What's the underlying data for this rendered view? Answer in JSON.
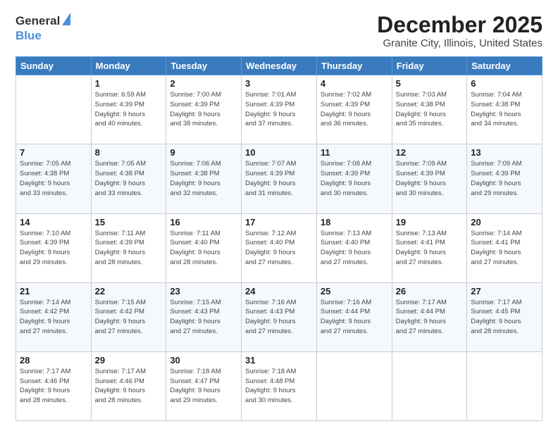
{
  "header": {
    "logo_general": "General",
    "logo_blue": "Blue",
    "month": "December 2025",
    "location": "Granite City, Illinois, United States"
  },
  "weekdays": [
    "Sunday",
    "Monday",
    "Tuesday",
    "Wednesday",
    "Thursday",
    "Friday",
    "Saturday"
  ],
  "weeks": [
    [
      {
        "day": "",
        "info": ""
      },
      {
        "day": "1",
        "info": "Sunrise: 6:59 AM\nSunset: 4:39 PM\nDaylight: 9 hours\nand 40 minutes."
      },
      {
        "day": "2",
        "info": "Sunrise: 7:00 AM\nSunset: 4:39 PM\nDaylight: 9 hours\nand 38 minutes."
      },
      {
        "day": "3",
        "info": "Sunrise: 7:01 AM\nSunset: 4:39 PM\nDaylight: 9 hours\nand 37 minutes."
      },
      {
        "day": "4",
        "info": "Sunrise: 7:02 AM\nSunset: 4:39 PM\nDaylight: 9 hours\nand 36 minutes."
      },
      {
        "day": "5",
        "info": "Sunrise: 7:03 AM\nSunset: 4:38 PM\nDaylight: 9 hours\nand 35 minutes."
      },
      {
        "day": "6",
        "info": "Sunrise: 7:04 AM\nSunset: 4:38 PM\nDaylight: 9 hours\nand 34 minutes."
      }
    ],
    [
      {
        "day": "7",
        "info": "Sunrise: 7:05 AM\nSunset: 4:38 PM\nDaylight: 9 hours\nand 33 minutes."
      },
      {
        "day": "8",
        "info": "Sunrise: 7:05 AM\nSunset: 4:38 PM\nDaylight: 9 hours\nand 33 minutes."
      },
      {
        "day": "9",
        "info": "Sunrise: 7:06 AM\nSunset: 4:38 PM\nDaylight: 9 hours\nand 32 minutes."
      },
      {
        "day": "10",
        "info": "Sunrise: 7:07 AM\nSunset: 4:39 PM\nDaylight: 9 hours\nand 31 minutes."
      },
      {
        "day": "11",
        "info": "Sunrise: 7:08 AM\nSunset: 4:39 PM\nDaylight: 9 hours\nand 30 minutes."
      },
      {
        "day": "12",
        "info": "Sunrise: 7:09 AM\nSunset: 4:39 PM\nDaylight: 9 hours\nand 30 minutes."
      },
      {
        "day": "13",
        "info": "Sunrise: 7:09 AM\nSunset: 4:39 PM\nDaylight: 9 hours\nand 29 minutes."
      }
    ],
    [
      {
        "day": "14",
        "info": "Sunrise: 7:10 AM\nSunset: 4:39 PM\nDaylight: 9 hours\nand 29 minutes."
      },
      {
        "day": "15",
        "info": "Sunrise: 7:11 AM\nSunset: 4:39 PM\nDaylight: 9 hours\nand 28 minutes."
      },
      {
        "day": "16",
        "info": "Sunrise: 7:11 AM\nSunset: 4:40 PM\nDaylight: 9 hours\nand 28 minutes."
      },
      {
        "day": "17",
        "info": "Sunrise: 7:12 AM\nSunset: 4:40 PM\nDaylight: 9 hours\nand 27 minutes."
      },
      {
        "day": "18",
        "info": "Sunrise: 7:13 AM\nSunset: 4:40 PM\nDaylight: 9 hours\nand 27 minutes."
      },
      {
        "day": "19",
        "info": "Sunrise: 7:13 AM\nSunset: 4:41 PM\nDaylight: 9 hours\nand 27 minutes."
      },
      {
        "day": "20",
        "info": "Sunrise: 7:14 AM\nSunset: 4:41 PM\nDaylight: 9 hours\nand 27 minutes."
      }
    ],
    [
      {
        "day": "21",
        "info": "Sunrise: 7:14 AM\nSunset: 4:42 PM\nDaylight: 9 hours\nand 27 minutes."
      },
      {
        "day": "22",
        "info": "Sunrise: 7:15 AM\nSunset: 4:42 PM\nDaylight: 9 hours\nand 27 minutes."
      },
      {
        "day": "23",
        "info": "Sunrise: 7:15 AM\nSunset: 4:43 PM\nDaylight: 9 hours\nand 27 minutes."
      },
      {
        "day": "24",
        "info": "Sunrise: 7:16 AM\nSunset: 4:43 PM\nDaylight: 9 hours\nand 27 minutes."
      },
      {
        "day": "25",
        "info": "Sunrise: 7:16 AM\nSunset: 4:44 PM\nDaylight: 9 hours\nand 27 minutes."
      },
      {
        "day": "26",
        "info": "Sunrise: 7:17 AM\nSunset: 4:44 PM\nDaylight: 9 hours\nand 27 minutes."
      },
      {
        "day": "27",
        "info": "Sunrise: 7:17 AM\nSunset: 4:45 PM\nDaylight: 9 hours\nand 28 minutes."
      }
    ],
    [
      {
        "day": "28",
        "info": "Sunrise: 7:17 AM\nSunset: 4:46 PM\nDaylight: 9 hours\nand 28 minutes."
      },
      {
        "day": "29",
        "info": "Sunrise: 7:17 AM\nSunset: 4:46 PM\nDaylight: 9 hours\nand 28 minutes."
      },
      {
        "day": "30",
        "info": "Sunrise: 7:18 AM\nSunset: 4:47 PM\nDaylight: 9 hours\nand 29 minutes."
      },
      {
        "day": "31",
        "info": "Sunrise: 7:18 AM\nSunset: 4:48 PM\nDaylight: 9 hours\nand 30 minutes."
      },
      {
        "day": "",
        "info": ""
      },
      {
        "day": "",
        "info": ""
      },
      {
        "day": "",
        "info": ""
      }
    ]
  ]
}
